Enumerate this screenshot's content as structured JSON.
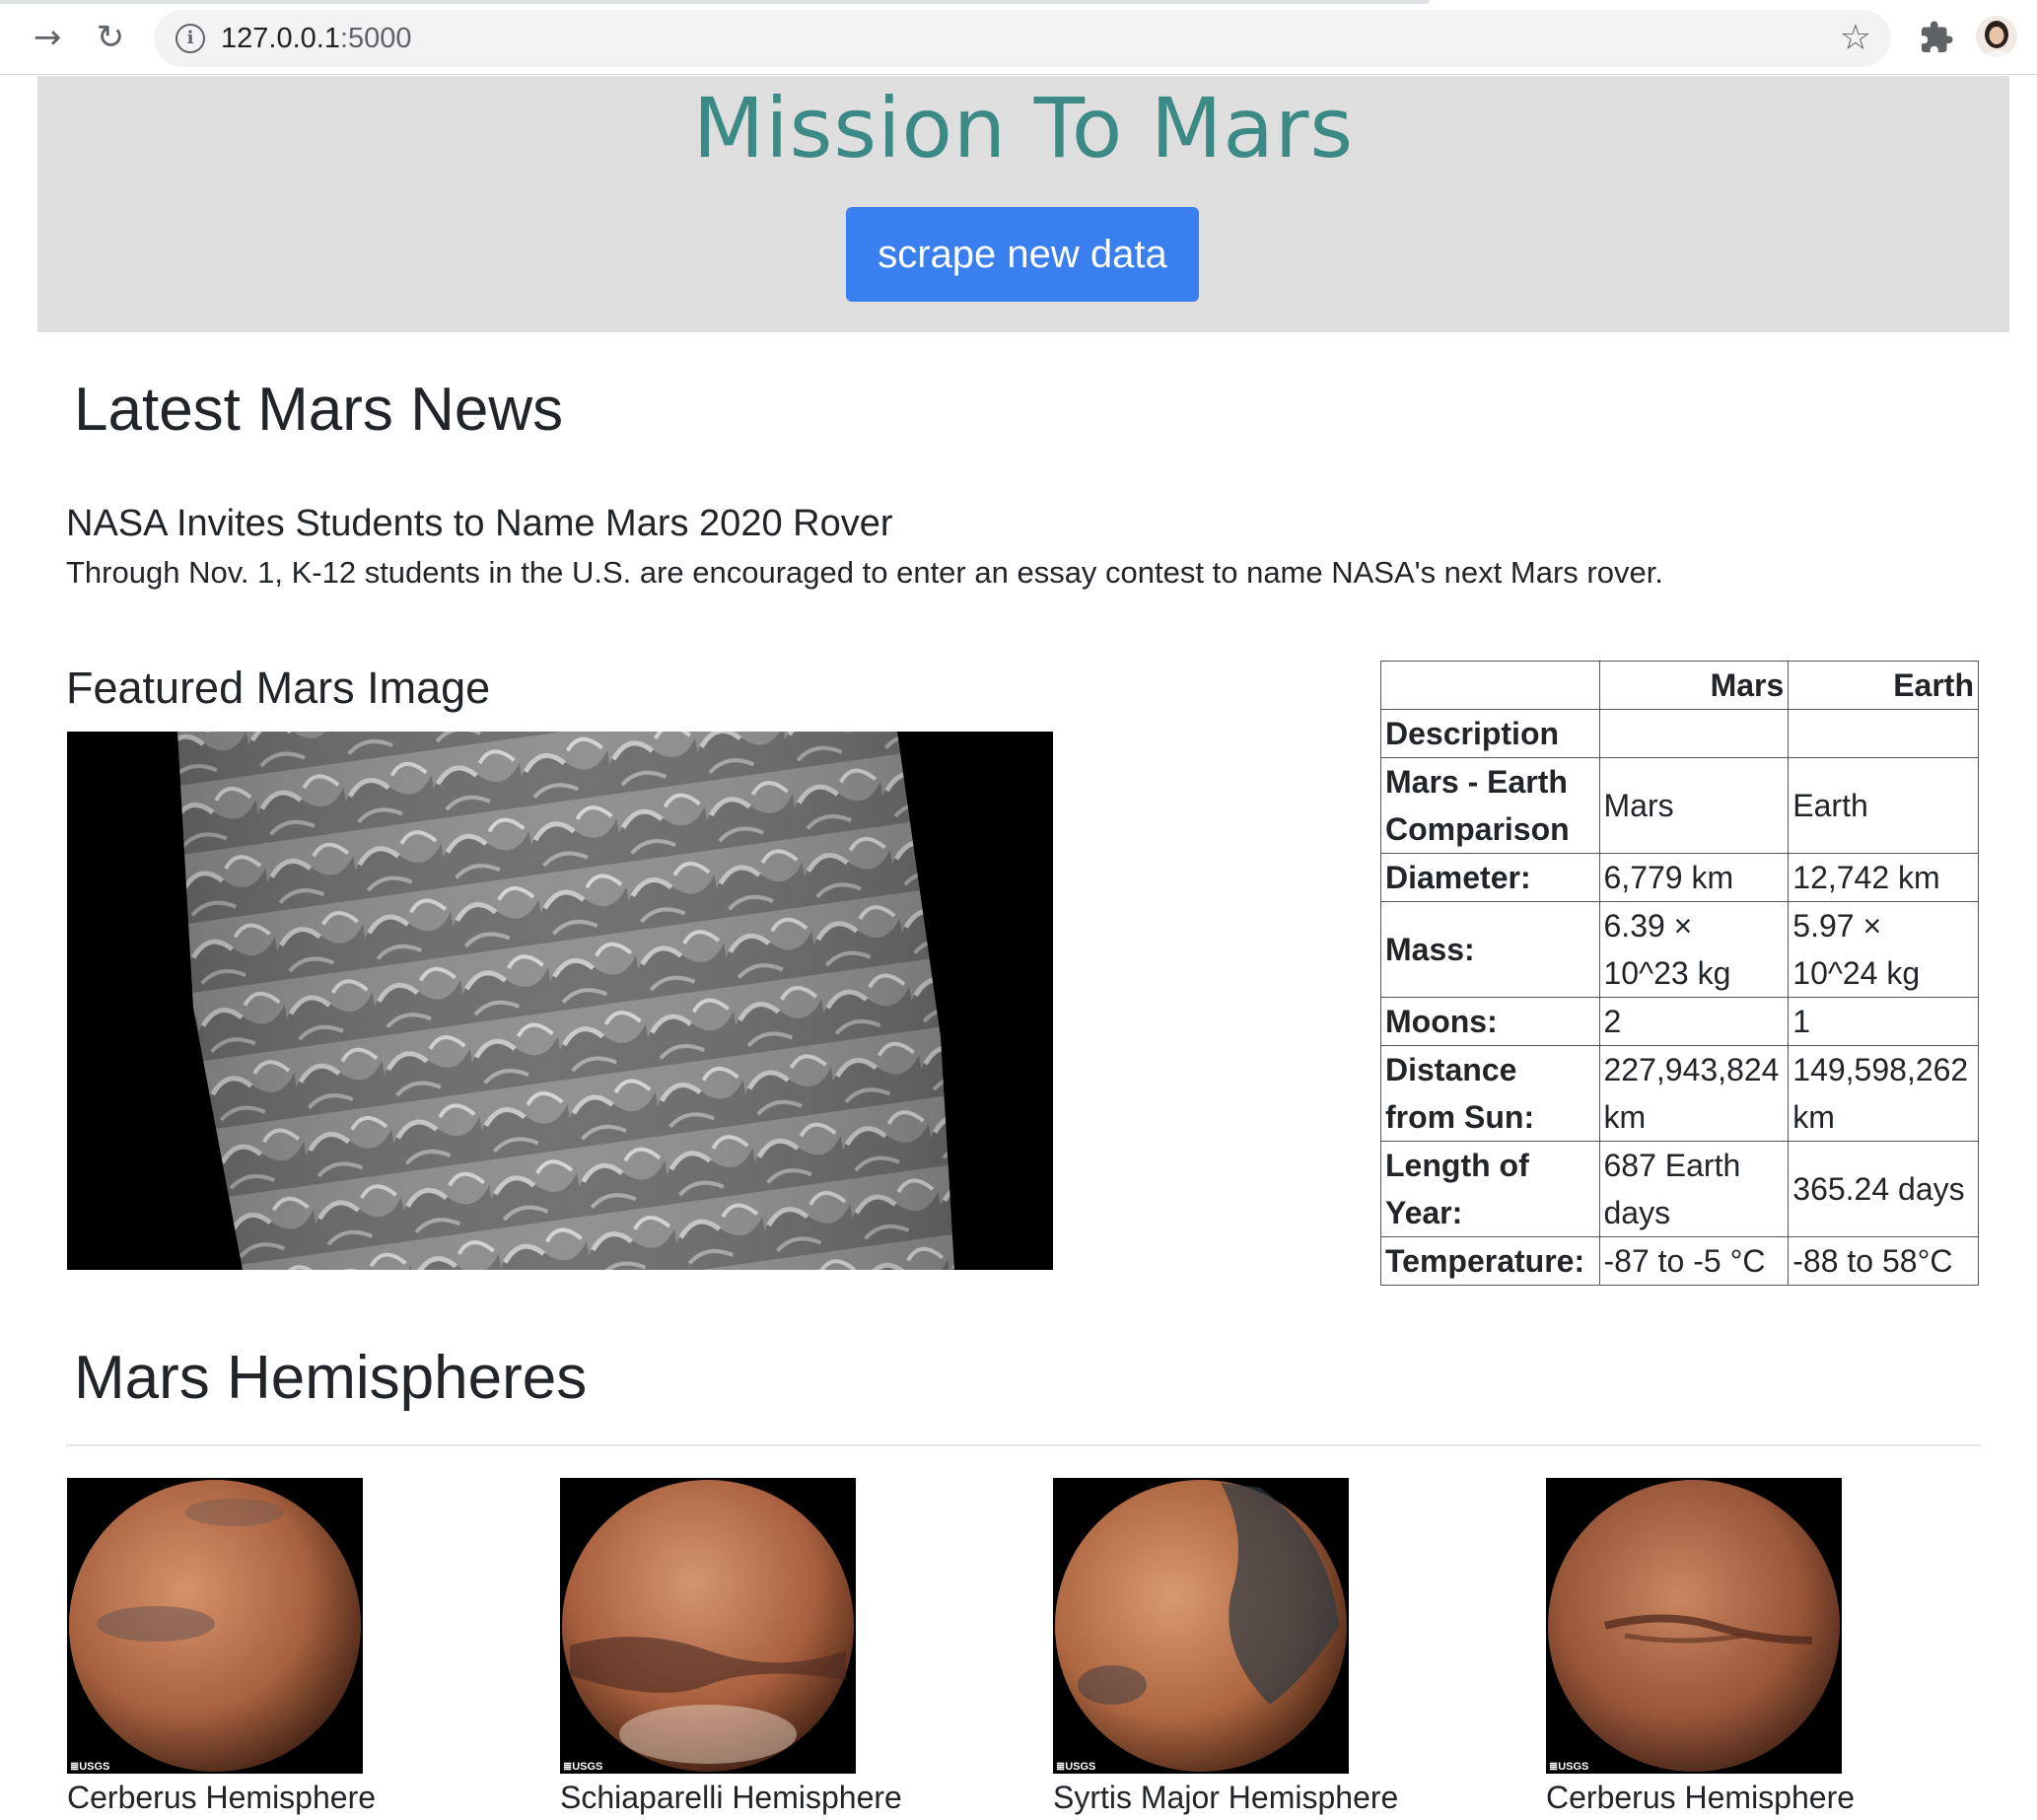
{
  "browser": {
    "url_host": "127.0.0.1",
    "url_port": ":5000",
    "back_icon": "→",
    "reload_icon": "↻",
    "star_icon": "☆",
    "info_icon": "i"
  },
  "header": {
    "title": "Mission To Mars",
    "scrape_label": "scrape new data",
    "title_color": "#3b8a86",
    "button_color": "#3a7fef"
  },
  "news": {
    "heading": "Latest Mars News",
    "title": "NASA Invites Students to Name Mars 2020 Rover",
    "paragraph": "Through Nov. 1, K-12 students in the U.S. are encouraged to enter an essay contest to name NASA's next Mars rover."
  },
  "featured": {
    "heading": "Featured Mars Image"
  },
  "facts": {
    "columns": [
      "",
      "Mars",
      "Earth"
    ],
    "rows": [
      {
        "key": "Description",
        "mars": "",
        "earth": ""
      },
      {
        "key": "Mars - Earth Comparison",
        "mars": "Mars",
        "earth": "Earth"
      },
      {
        "key": "Diameter:",
        "mars": "6,779 km",
        "earth": "12,742 km"
      },
      {
        "key": "Mass:",
        "mars": "6.39 × 10^23 kg",
        "earth": "5.97 × 10^24 kg"
      },
      {
        "key": "Moons:",
        "mars": "2",
        "earth": "1"
      },
      {
        "key": "Distance from Sun:",
        "mars": "227,943,824 km",
        "earth": "149,598,262 km"
      },
      {
        "key": "Length of Year:",
        "mars": "687 Earth days",
        "earth": "365.24 days"
      },
      {
        "key": "Temperature:",
        "mars": "-87 to -5 °C",
        "earth": "-88 to 58°C"
      }
    ]
  },
  "hemispheres": {
    "heading": "Mars Hemispheres",
    "items": [
      {
        "title": "Cerberus Hemisphere",
        "logo": "≣USGS"
      },
      {
        "title": "Schiaparelli Hemisphere",
        "logo": "≣USGS"
      },
      {
        "title": "Syrtis Major Hemisphere",
        "logo": "≣USGS"
      },
      {
        "title": "Cerberus Hemisphere",
        "logo": "≣USGS"
      }
    ]
  }
}
